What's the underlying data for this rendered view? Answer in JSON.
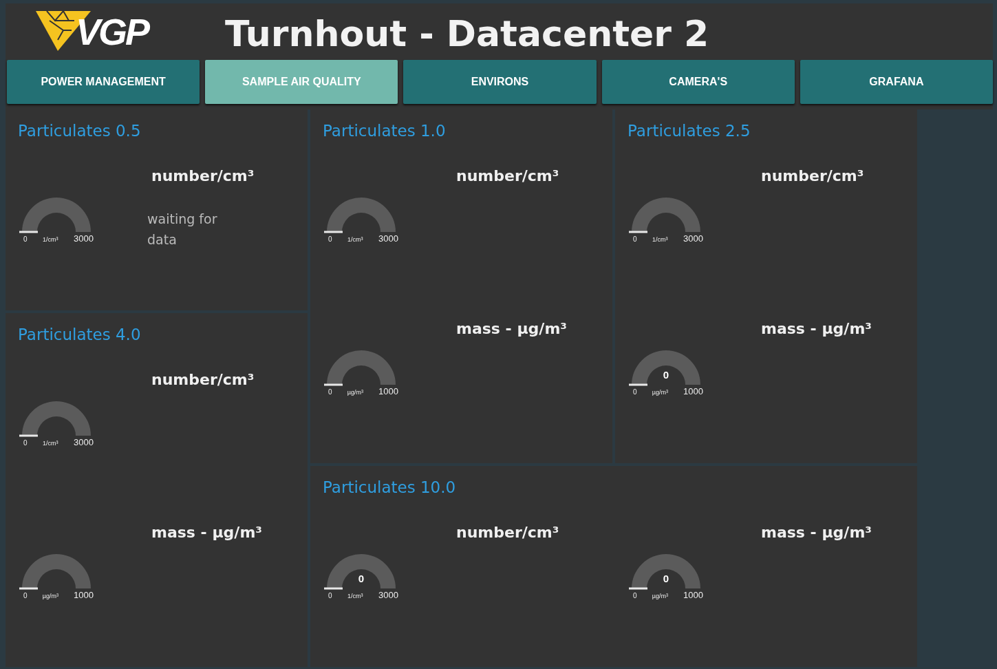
{
  "header": {
    "logo": "VGP",
    "title": "Turnhout - Datacenter 2"
  },
  "tabs": [
    {
      "label": "POWER MANAGEMENT",
      "selected": false
    },
    {
      "label": "SAMPLE AIR QUALITY",
      "selected": true
    },
    {
      "label": "ENVIRONS",
      "selected": false
    },
    {
      "label": "CAMERA'S",
      "selected": false
    },
    {
      "label": "GRAFANA",
      "selected": false
    }
  ],
  "cards": [
    {
      "title": "Particulates 0.5",
      "gauges": [
        {
          "label": "number/cm³",
          "min": "0",
          "max": "3000",
          "unit": "1/cm³",
          "status": "waiting for data"
        }
      ]
    },
    {
      "title": "Particulates 1.0",
      "gauges": [
        {
          "label": "number/cm³",
          "min": "0",
          "max": "3000",
          "unit": "1/cm³"
        },
        {
          "label": "mass - µg/m³",
          "min": "0",
          "max": "1000",
          "unit": "µg/m³"
        }
      ]
    },
    {
      "title": "Particulates 2.5",
      "gauges": [
        {
          "label": "number/cm³",
          "min": "0",
          "max": "3000",
          "unit": "1/cm³"
        },
        {
          "label": "mass - µg/m³",
          "min": "0",
          "max": "1000",
          "unit": "µg/m³",
          "value": "0"
        }
      ]
    },
    {
      "title": "Particulates 4.0",
      "gauges": [
        {
          "label": "number/cm³",
          "min": "0",
          "max": "3000",
          "unit": "1/cm³"
        },
        {
          "label": "mass - µg/m³",
          "min": "0",
          "max": "1000",
          "unit": "µg/m³"
        }
      ]
    },
    {
      "title": "Particulates 10.0",
      "gauges": [
        {
          "label": "number/cm³",
          "min": "0",
          "max": "3000",
          "unit": "1/cm³",
          "value": "0"
        },
        {
          "label": "mass - µg/m³",
          "min": "0",
          "max": "1000",
          "unit": "µg/m³",
          "value": "0"
        }
      ]
    }
  ]
}
